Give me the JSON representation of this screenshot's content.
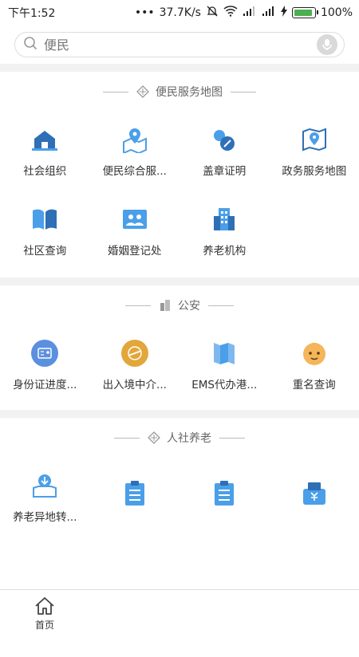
{
  "status": {
    "time": "下午1:52",
    "dots": "•••",
    "speed": "37.7K/s",
    "battery": "100%"
  },
  "search": {
    "placeholder": "便民"
  },
  "sections": [
    {
      "title": "便民服务地图",
      "items": [
        "社会组织",
        "便民综合服...",
        "盖章证明",
        "政务服务地图",
        "社区查询",
        "婚姻登记处",
        "养老机构"
      ]
    },
    {
      "title": "公安",
      "items": [
        "身份证进度...",
        "出入境中介...",
        "EMS代办港...",
        "重名查询"
      ]
    },
    {
      "title": "人社养老",
      "items": [
        "养老异地转...",
        "",
        "",
        ""
      ]
    }
  ],
  "tabbar": {
    "home_label": "首页"
  },
  "colors": {
    "icon_blue": "#4a9fe8",
    "icon_dark": "#2e6fb6",
    "ring_blue": "#5b8fe0",
    "ring_orange": "#e3a63a"
  }
}
